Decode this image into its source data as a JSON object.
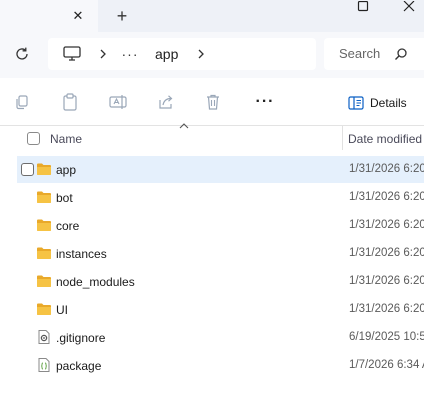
{
  "window": {
    "tab_close_glyph": "✕",
    "new_tab_glyph": "+"
  },
  "address_bar": {
    "overflow_glyph": "···",
    "current_folder": "app"
  },
  "search": {
    "placeholder": "Search"
  },
  "command_bar": {
    "more_glyph": "···",
    "details_label": "Details"
  },
  "columns": {
    "name": "Name",
    "date_modified": "Date modified"
  },
  "files": [
    {
      "name": "app",
      "date": "1/31/2026 6:20",
      "type": "folder",
      "selected": true
    },
    {
      "name": "bot",
      "date": "1/31/2026 6:20",
      "type": "folder"
    },
    {
      "name": "core",
      "date": "1/31/2026 6:20",
      "type": "folder"
    },
    {
      "name": "instances",
      "date": "1/31/2026 6:20",
      "type": "folder"
    },
    {
      "name": "node_modules",
      "date": "1/31/2026 6:20",
      "type": "folder"
    },
    {
      "name": "UI",
      "date": "1/31/2026 6:20",
      "type": "folder"
    },
    {
      "name": ".gitignore",
      "date": "6/19/2025 10:5",
      "type": "gitignore-file"
    },
    {
      "name": "package",
      "date": "1/7/2026 6:34 A",
      "type": "json-file"
    }
  ],
  "colors": {
    "accent": "#0a5fc4",
    "folder_yellow": "#f6c344",
    "selection": "#e5f0fc",
    "disabled_icon": "#9aa7b8"
  }
}
